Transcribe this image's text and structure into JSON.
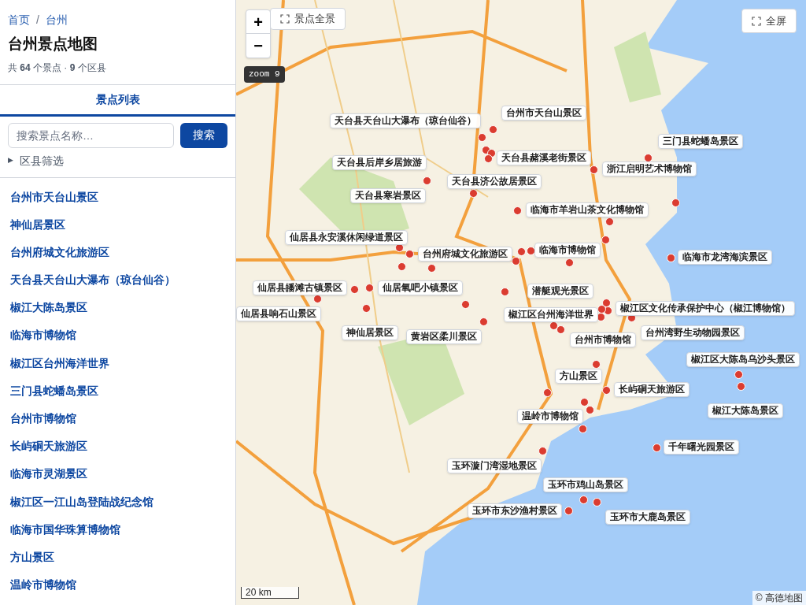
{
  "breadcrumb": [
    {
      "label": "首页"
    },
    {
      "label": "台州"
    }
  ],
  "breadcrumb_separator": "/",
  "title": "台州景点地图",
  "summary": "共 **64** 个景点 · **9** 个区县",
  "tabs": [
    {
      "label": "景点列表",
      "selected": true
    }
  ],
  "search": {
    "placeholder": "搜索景点名称…",
    "button": "搜索"
  },
  "filter": {
    "label": "区县筛选",
    "expanded": false,
    "icon": "▶"
  },
  "spots": [
    "台州市天台山景区",
    "神仙居景区",
    "台州府城文化旅游区",
    "天台县天台山大瀑布（琼台仙谷）",
    "椒江大陈岛景区",
    "临海市博物馆",
    "椒江区台州海洋世界",
    "三门县蛇蟠岛景区",
    "台州市博物馆",
    "长屿硐天旅游区",
    "临海市灵湖景区",
    "椒江区一江山岛登陆战纪念馆",
    "临海市国华珠算博物馆",
    "方山景区",
    "温岭市博物馆"
  ],
  "map": {
    "fit_button": "景点全景",
    "zoom_in": "+",
    "zoom_out": "−",
    "zoom_badge": "zoom 9",
    "fullscreen_button": "全屏",
    "scale": "20 km",
    "attribution": "© 高德地图",
    "labels": [
      "台州市天台山景区",
      "天台县天台山大瀑布（琼台仙谷）",
      "三门县蛇蟠岛景区",
      "天台县赭溪老街景区",
      "天台县后岸乡居旅游",
      "浙江启明艺术博物馆",
      "天台县济公故居景区",
      "天台县寒岩景区",
      "临海市羊岩山茶文化博物馆",
      "仙居县永安溪休闲绿道景区",
      "台州府城文化旅游区",
      "临海市博物馆",
      "临海市龙湾海滨景区",
      "仙居县皤滩古镇景区",
      "仙居氧吧小镇景区",
      "潜艇观光景区",
      "椒江区文化传承保护中心（椒江博物馆）",
      "仙居县响石山景区",
      "椒江区台州海洋世界",
      "神仙居景区",
      "黄岩区柔川景区",
      "台州湾野生动物园景区",
      "台州市博物馆",
      "椒江区大陈岛乌沙头景区",
      "方山景区",
      "长屿硐天旅游区",
      "椒江大陈岛景区",
      "温岭市博物馆",
      "千年曙光园景区",
      "玉环漩门湾湿地景区",
      "玉环市鸡山岛景区",
      "玉环市东沙渔村景区",
      "玉环市大鹿岛景区"
    ]
  }
}
